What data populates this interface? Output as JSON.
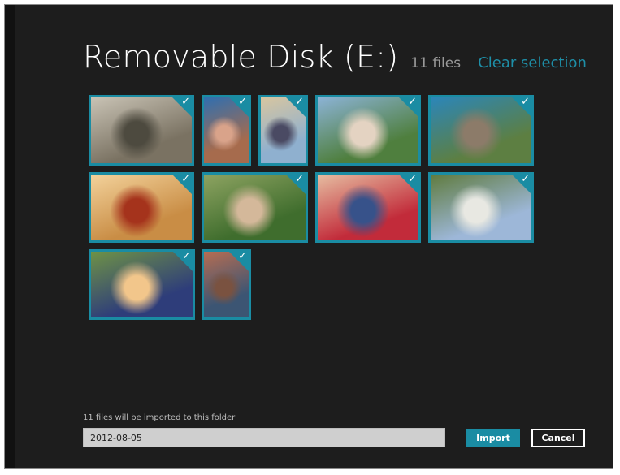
{
  "header": {
    "title": "Removable Disk (E:)",
    "file_count": "11 files",
    "clear_selection": "Clear selection"
  },
  "photos": [
    {
      "colors": [
        "#7a7262",
        "#c9c3b5",
        "#4d4a3f"
      ],
      "selected": true
    },
    {
      "colors": [
        "#a66b4d",
        "#2f6fb0",
        "#d9a38a"
      ],
      "selected": true
    },
    {
      "colors": [
        "#8fb0cf",
        "#d8c6a0",
        "#4a4a63"
      ],
      "selected": true
    },
    {
      "colors": [
        "#4f7f3e",
        "#8cb3d6",
        "#e4d3c2"
      ],
      "selected": true
    },
    {
      "colors": [
        "#5d7f42",
        "#2b86b9",
        "#8c7b69"
      ],
      "selected": true
    },
    {
      "colors": [
        "#c98d45",
        "#f3d29b",
        "#a5331c"
      ],
      "selected": true
    },
    {
      "colors": [
        "#3f6d2d",
        "#8da361",
        "#d4b89a"
      ],
      "selected": true
    },
    {
      "colors": [
        "#c22b3a",
        "#e6bda1",
        "#37528a"
      ],
      "selected": true
    },
    {
      "colors": [
        "#9db7d8",
        "#5f7b3e",
        "#e8e8e2"
      ],
      "selected": true
    },
    {
      "colors": [
        "#2e3d7a",
        "#6e9246",
        "#f2c68b"
      ],
      "selected": true
    },
    {
      "colors": [
        "#3c5573",
        "#b66d52",
        "#7a5240"
      ],
      "selected": true
    }
  ],
  "footer": {
    "status_text": "11 files will be imported to this folder",
    "folder_name": "2012-08-05",
    "import_label": "Import",
    "cancel_label": "Cancel"
  },
  "colors": {
    "accent": "#1a8ca3",
    "background": "#1d1d1d"
  },
  "icons": {
    "selection_check": "✓"
  }
}
